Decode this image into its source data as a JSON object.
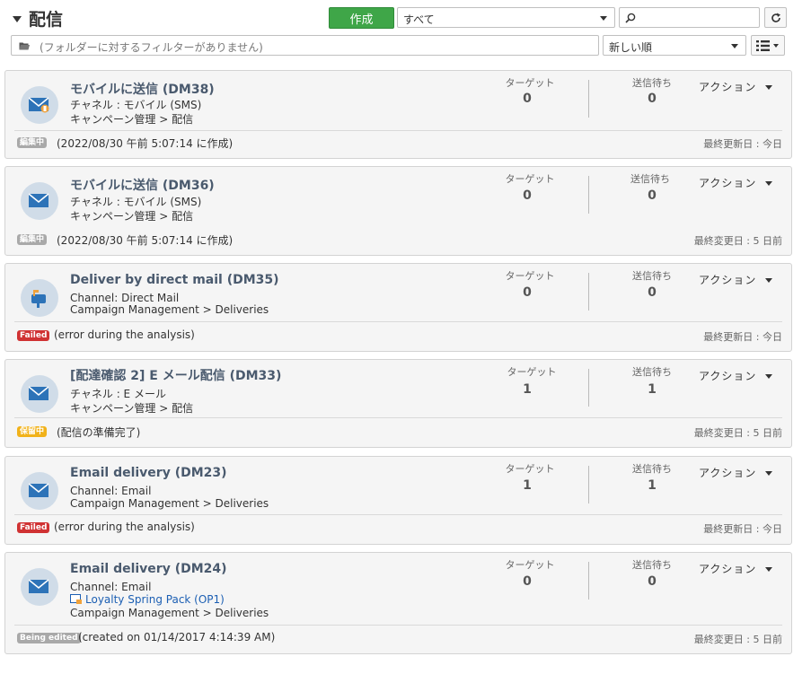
{
  "header": {
    "title": "配信",
    "create_label": "作成",
    "filter_select": "すべて",
    "search_placeholder": "",
    "folder_filter_text": "(フォルダーに対するフィルターがありません)",
    "sort_select": "新しい順"
  },
  "labels": {
    "target": "ターゲット",
    "pending": "送信待ち",
    "action": "アクション"
  },
  "deliveries": [
    {
      "title": "モバイルに送信 (DM38)",
      "line1": "チャネル : モバイル (SMS)",
      "line2": "キャンペーン管理 > 配信",
      "target": "0",
      "pending": "0",
      "badge": "編集中",
      "footer": "(2022/08/30 午前 5:07:14 に作成)",
      "updated": "最終更新日 : 今日"
    },
    {
      "title": "モバイルに送信 (DM36)",
      "line1": "チャネル : モバイル (SMS)",
      "line2": "キャンペーン管理 > 配信",
      "target": "0",
      "pending": "0",
      "badge": "編集中",
      "footer": "(2022/08/30 午前 5:07:14 に作成)",
      "updated": "最終変更日 : 5 日前"
    },
    {
      "title": "Deliver by direct mail (DM35)",
      "line1": "Channel: Direct Mail",
      "line2": "Campaign Management > Deliveries",
      "target": "0",
      "pending": "0",
      "badge": "Failed",
      "footer": "(error during the analysis)",
      "updated": "最終更新日 : 今日"
    },
    {
      "title": "[配達確認 2] E メール配信 (DM33)",
      "line1": "チャネル : E メール",
      "line2": "キャンペーン管理 > 配信",
      "target": "1",
      "pending": "1",
      "badge": "保留中",
      "footer": "(配信の準備完了)",
      "updated": "最終変更日 : 5 日前"
    },
    {
      "title": "Email delivery (DM23)",
      "line1": "Channel: Email",
      "line2": "Campaign Management > Deliveries",
      "target": "1",
      "pending": "1",
      "badge": "Failed",
      "footer": "(error during the analysis)",
      "updated": "最終更新日 : 今日"
    },
    {
      "title": "Email delivery (DM24)",
      "line1": "Channel: Email",
      "link": "Loyalty Spring Pack (OP1)",
      "line2": "Campaign Management > Deliveries",
      "target": "0",
      "pending": "0",
      "badge": "Being edited",
      "footer": "(created on 01/14/2017 4:14:39 AM)",
      "updated": "最終変更日 : 5 日前"
    }
  ],
  "colors": {
    "create_button": "#3fa648",
    "badge_failed": "#d03233",
    "badge_edit": "#a9a9a9",
    "badge_hold": "#f1b21a",
    "link": "#1c5fb3"
  },
  "icons": [
    "mobile-delivery-icon",
    "direct-mail-icon",
    "email-delivery-icon"
  ]
}
